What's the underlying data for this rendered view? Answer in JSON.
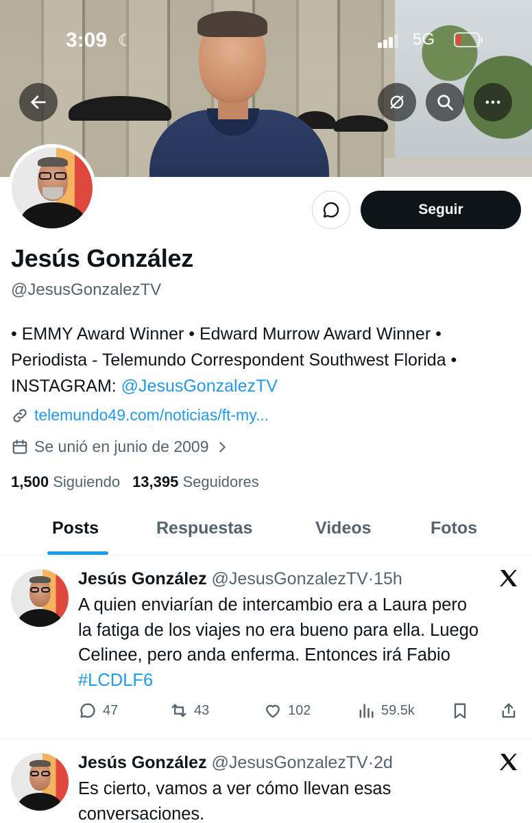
{
  "status_bar": {
    "time": "3:09",
    "network": "5G"
  },
  "header": {
    "back_label": "back",
    "bookmark_label": "",
    "search_label": "",
    "more_label": ""
  },
  "profile": {
    "name": "Jesús González",
    "handle": "@JesusGonzalezTV",
    "follow_label": "Seguir",
    "bio_line1": "• EMMY Award Winner • Edward Murrow Award Winner •",
    "bio_line2": "Periodista - Telemundo Correspondent Southwest Florida •",
    "bio_line3_prefix": "INSTAGRAM: ",
    "bio_line3_link": "@JesusGonzalezTV",
    "website": "telemundo49.com/noticias/ft-my...",
    "joined": "Se unió en junio de 2009",
    "following_count": "1,500",
    "following_label": "Siguiendo",
    "followers_count": "13,395",
    "followers_label": "Seguidores"
  },
  "tabs": [
    {
      "label": "Posts",
      "active": true
    },
    {
      "label": "Respuestas",
      "active": false
    },
    {
      "label": "Videos",
      "active": false
    },
    {
      "label": "Fotos",
      "active": false
    }
  ],
  "tweets": [
    {
      "name": "Jesús González",
      "handle": "@JesusGonzalezTV",
      "time": "15h",
      "text_line1": "A quien enviarían de intercambio era a Laura pero",
      "text_line2": "la fatiga de los viajes no era bueno para ella. Luego",
      "text_line3": "Celinee, pero anda enferma. Entonces irá Fabio",
      "hashtag": "#LCDLF6",
      "replies": "47",
      "reposts": "43",
      "likes": "102",
      "views": "59.5k"
    },
    {
      "name": "Jesús González",
      "handle": "@JesusGonzalezTV",
      "time": "2d",
      "text_line1": "Es cierto, vamos a ver cómo llevan esas",
      "text_line2": "conversaciones."
    }
  ],
  "colors": {
    "accent": "#1d9bf0",
    "text": "#0f1419",
    "muted": "#536471"
  }
}
